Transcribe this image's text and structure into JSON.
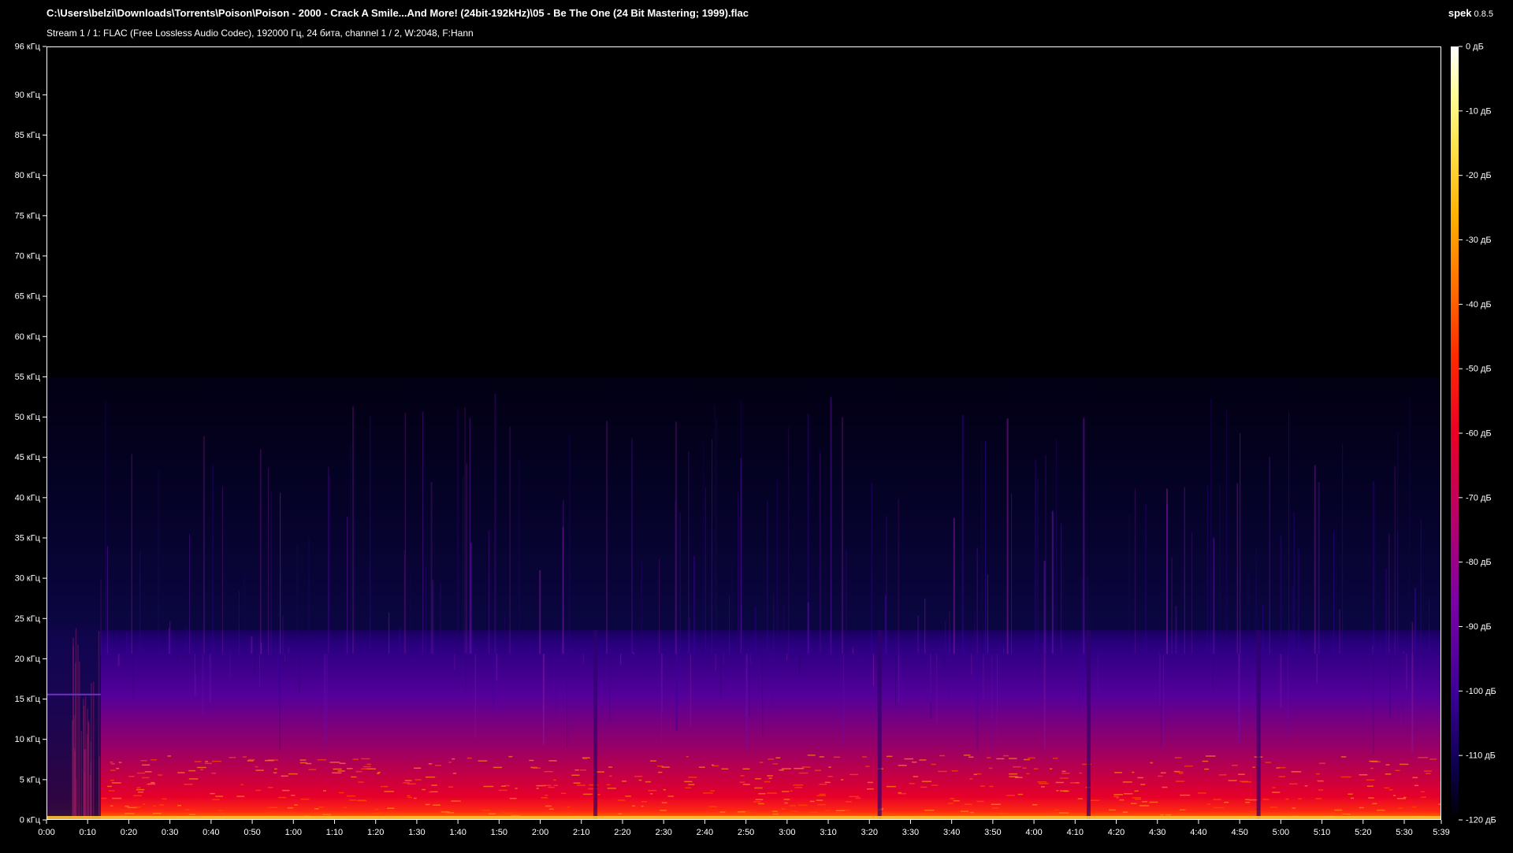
{
  "header": {
    "file_path": "C:\\Users\\belzi\\Downloads\\Torrents\\Poison\\Poison - 2000 - Crack A Smile...And More! (24bit-192kHz)\\05 - Be The One (24 Bit Mastering; 1999).flac",
    "stream_info": "Stream 1 / 1: FLAC (Free Lossless Audio Codec), 192000 Гц, 24 бита, channel 1 / 2, W:2048, F:Hann",
    "app_name": "spek",
    "app_version": "0.8.5"
  },
  "chart_data": {
    "type": "heatmap",
    "title": "",
    "y_ticks": [
      "96 кГц",
      "90 кГц",
      "85 кГц",
      "80 кГц",
      "75 кГц",
      "70 кГц",
      "65 кГц",
      "60 кГц",
      "55 кГц",
      "50 кГц",
      "45 кГц",
      "40 кГц",
      "35 кГц",
      "30 кГц",
      "25 кГц",
      "20 кГц",
      "15 кГц",
      "10 кГц",
      "5 кГц",
      "0 кГц"
    ],
    "y_tick_values_khz": [
      96,
      90,
      85,
      80,
      75,
      70,
      65,
      60,
      55,
      50,
      45,
      40,
      35,
      30,
      25,
      20,
      15,
      10,
      5,
      0
    ],
    "ylim_khz": [
      0,
      96
    ],
    "x_ticks": [
      "0:00",
      "0:10",
      "0:20",
      "0:30",
      "0:40",
      "0:50",
      "1:00",
      "1:10",
      "1:20",
      "1:30",
      "1:40",
      "1:50",
      "2:00",
      "2:10",
      "2:20",
      "2:30",
      "2:40",
      "2:50",
      "3:00",
      "3:10",
      "3:20",
      "3:30",
      "3:40",
      "3:50",
      "4:00",
      "4:10",
      "4:20",
      "4:30",
      "4:40",
      "4:50",
      "5:00",
      "5:10",
      "5:20",
      "5:30",
      "5:39"
    ],
    "x_tick_values_s": [
      0,
      10,
      20,
      30,
      40,
      50,
      60,
      70,
      80,
      90,
      100,
      110,
      120,
      130,
      140,
      150,
      160,
      170,
      180,
      190,
      200,
      210,
      220,
      230,
      240,
      250,
      260,
      270,
      280,
      290,
      300,
      310,
      320,
      330,
      339
    ],
    "xlim_s": [
      0,
      339
    ],
    "colorbar_ticks": [
      "0 дБ",
      "-10 дБ",
      "-20 дБ",
      "-30 дБ",
      "-40 дБ",
      "-50 дБ",
      "-60 дБ",
      "-70 дБ",
      "-80 дБ",
      "-90 дБ",
      "-100 дБ",
      "-110 дБ",
      "-120 дБ"
    ],
    "colorbar_values_db": [
      0,
      -10,
      -20,
      -30,
      -40,
      -50,
      -60,
      -70,
      -80,
      -90,
      -100,
      -110,
      -120
    ],
    "colorbar_range_db": [
      -120,
      0
    ],
    "colormap": [
      "#000000",
      "#0d0050",
      "#3a0096",
      "#7a00a6",
      "#b8006a",
      "#ea0024",
      "#ff2a00",
      "#ff7000",
      "#ffb000",
      "#ffe24c",
      "#ffff9a",
      "#ffffff"
    ],
    "content_cutoff_khz": 23.5,
    "noise_floor_top_khz": 55
  }
}
